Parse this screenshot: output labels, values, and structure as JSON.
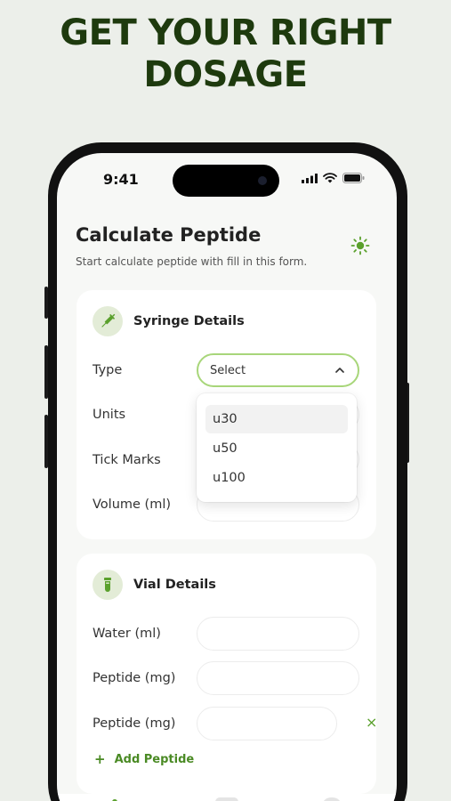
{
  "headline": {
    "line1": "GET YOUR RIGHT",
    "line2": "DOSAGE"
  },
  "status_bar": {
    "time": "9:41",
    "icons": [
      "signal-icon",
      "wifi-icon",
      "battery-icon"
    ]
  },
  "header": {
    "title": "Calculate Peptide",
    "subtitle": "Start calculate peptide with fill in this form.",
    "theme_toggle_icon": "sun-icon"
  },
  "syringe_card": {
    "title": "Syringe Details",
    "icon": "syringe-icon",
    "fields": [
      {
        "label": "Type",
        "value": "Select"
      },
      {
        "label": "Units",
        "value": ""
      },
      {
        "label": "Tick Marks",
        "value": ""
      },
      {
        "label": "Volume (ml)",
        "value": ""
      }
    ],
    "dropdown_options": [
      "u30",
      "u50",
      "u100"
    ],
    "highlighted_option": "u30"
  },
  "vial_card": {
    "title": "Vial Details",
    "icon": "vial-icon",
    "fields": [
      {
        "label": "Water (ml)",
        "value": ""
      },
      {
        "label": "Peptide (mg)",
        "value": ""
      },
      {
        "label": "Peptide (mg)",
        "value": ""
      }
    ],
    "remove_symbol": "×",
    "add_label": "Add Peptide",
    "add_symbol": "+"
  },
  "colors": {
    "brand_dark": "#1e3a0e",
    "accent_green": "#5aa02c",
    "focus_border": "#a8d67a",
    "badge_bg": "#e3ecd7",
    "page_bg": "#ecefea"
  }
}
